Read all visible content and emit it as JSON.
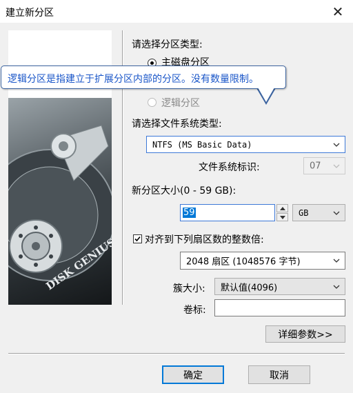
{
  "window": {
    "title": "建立新分区",
    "close_glyph": "✕"
  },
  "partition_type": {
    "label": "请选择分区类型:",
    "options": [
      {
        "label": "主磁盘分区",
        "selected": true,
        "enabled": true
      },
      {
        "label": "逻辑分区",
        "selected": false,
        "enabled": false
      }
    ]
  },
  "tooltip": {
    "text": "逻辑分区是指建立于扩展分区内部的分区。没有数量限制。"
  },
  "filesystem": {
    "label": "请选择文件系统类型:",
    "selected": "NTFS (MS Basic Data)",
    "id_label": "文件系统标识:",
    "id_value": "07"
  },
  "size": {
    "label": "新分区大小(0 - 59 GB):",
    "value": "59",
    "unit": "GB"
  },
  "align": {
    "label": "对齐到下列扇区数的整数倍:",
    "checked": true,
    "value": "2048 扇区 (1048576 字节)"
  },
  "cluster": {
    "label": "簇大小:",
    "value": "默认值(4096)"
  },
  "volume": {
    "label": "卷标:",
    "value": ""
  },
  "buttons": {
    "details": "详细参数>>",
    "ok": "确定",
    "cancel": "取消"
  },
  "branding": {
    "logo_text": "DISK GENIUS"
  },
  "colors": {
    "accent": "#0078d7",
    "tooltip_text": "#1a56c8",
    "tooltip_border": "#3c64a0"
  }
}
